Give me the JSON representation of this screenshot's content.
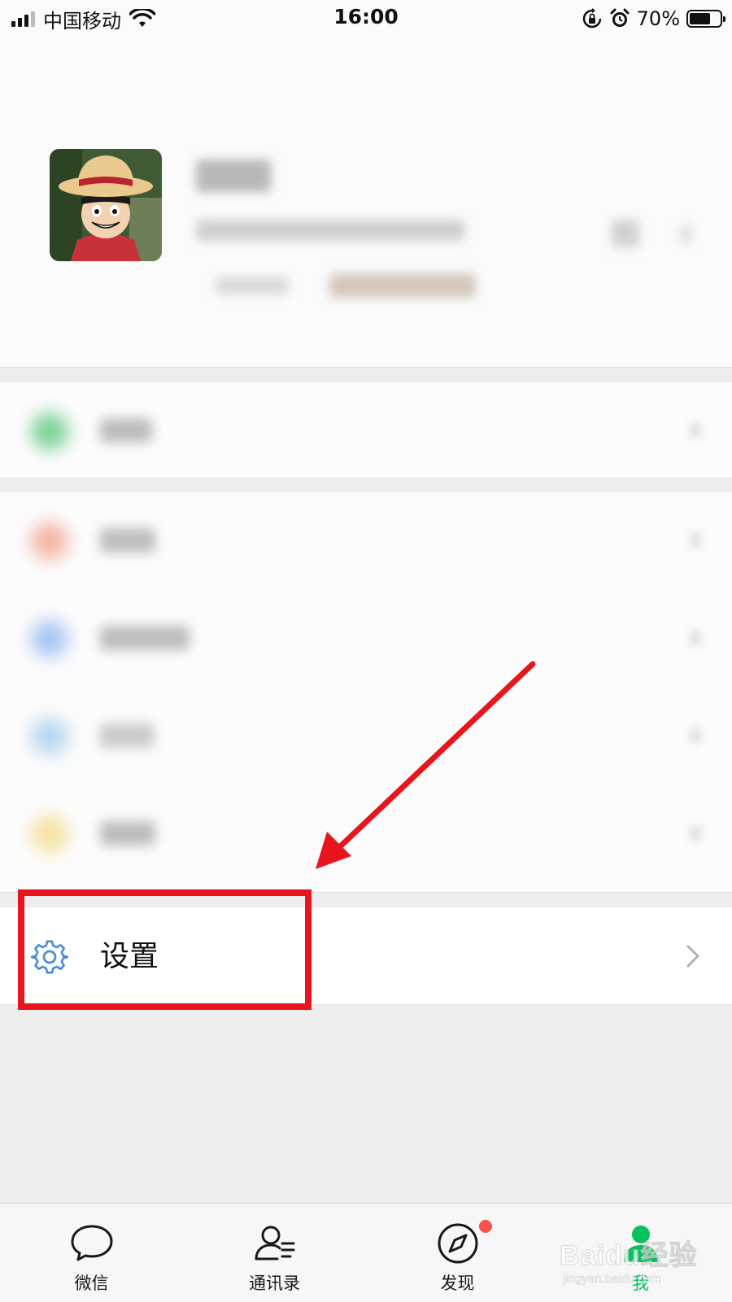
{
  "status_bar": {
    "carrier": "中国移动",
    "time": "16:00",
    "battery_percent": "70%",
    "battery_level": 0.7
  },
  "profile": {
    "avatar_icon": "cartoon-avatar-image",
    "name_blurred": true
  },
  "settings": {
    "label": "设置",
    "icon": "gear-icon",
    "icon_color": "#4a8fd6"
  },
  "tabbar": {
    "tabs": [
      {
        "label": "微信",
        "icon": "chat-bubble-icon",
        "active": false
      },
      {
        "label": "通讯录",
        "icon": "contacts-icon",
        "active": false
      },
      {
        "label": "发现",
        "icon": "compass-icon",
        "active": false,
        "badge": true
      },
      {
        "label": "我",
        "icon": "person-icon",
        "active": true
      }
    ],
    "active_color": "#07c160"
  },
  "annotation": {
    "color": "#e8141e",
    "shape": "arrow-to-box"
  },
  "watermark": {
    "logo": "Baidu经验",
    "sub": "jingyan.baidu.com"
  }
}
